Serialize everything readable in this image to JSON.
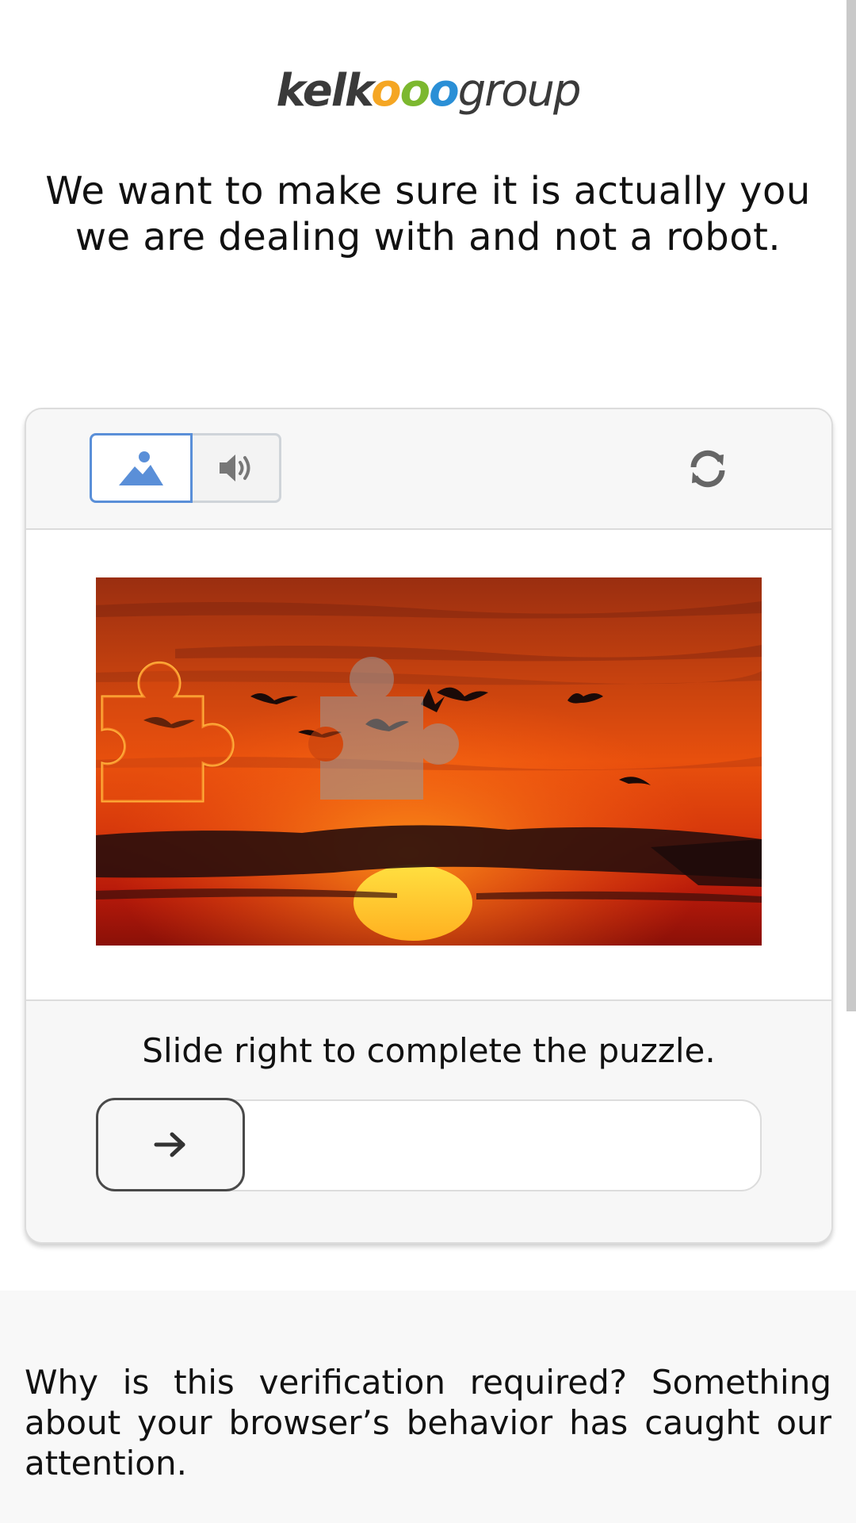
{
  "logo": {
    "part1": "kelk",
    "o1": "o",
    "o2": "o",
    "o3": "o",
    "part2": "group",
    "colors": {
      "text": "#3a3a3a",
      "o1": "#f5a623",
      "o2": "#7cb82f",
      "o3": "#2a8fd6"
    }
  },
  "headline": "We want to make sure it is actually you we are dealing with and not a robot.",
  "captcha": {
    "modes": [
      {
        "icon": "image-icon",
        "selected": true
      },
      {
        "icon": "speaker-icon",
        "selected": false
      }
    ],
    "refresh_icon": "refresh-icon",
    "instruction": "Slide right to complete the puzzle.",
    "slider_progress": 0,
    "slider_icon": "arrow-right-icon",
    "accent_color": "#5a8fd8"
  },
  "footer": {
    "why_text": "Why is this verification required? Something about your browser’s behavior has caught our attention."
  }
}
